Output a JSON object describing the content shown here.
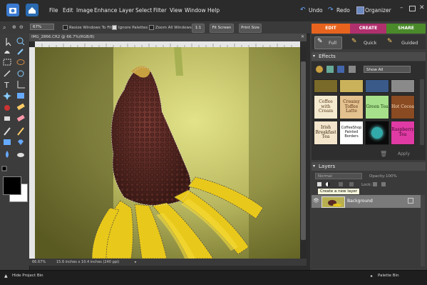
{
  "menubar": {
    "items": [
      "File",
      "Edit",
      "Image",
      "Enhance",
      "Layer",
      "Select",
      "Filter",
      "View",
      "Window",
      "Help"
    ],
    "undo": "Undo",
    "redo": "Redo",
    "organizer": "Organizer"
  },
  "options": {
    "zoom": "67%",
    "resize_windows": "Resize Windows To Fit",
    "ignore_palettes": "Ignore Palettes",
    "zoom_all": "Zoom All Windows",
    "one_to_one": "1:1",
    "fit_screen": "Fit Screen",
    "print_size": "Print Size"
  },
  "tabs": {
    "edit": "EDIT",
    "create": "CREATE",
    "share": "SHARE"
  },
  "modes": {
    "full": "Full",
    "quick": "Quick",
    "guided": "Guided"
  },
  "document": {
    "title": "IMG_2866.CR2 @ 66.7%(RGB/8)",
    "status_zoom": "66.67%",
    "status_info": "15.6 inches x 10.4 inches (240 ppi)"
  },
  "effects": {
    "header": "Effects",
    "show": "Show All",
    "apply": "Apply",
    "thumbs": [
      {
        "label": "",
        "bg": "#7a6a2a"
      },
      {
        "label": "",
        "bg": "#c9b25a"
      },
      {
        "label": "",
        "bg": "#3a5a8a"
      },
      {
        "label": "",
        "bg": "#8a8a8a"
      },
      {
        "label": "Coffee with Cream",
        "bg": "#f4ead0",
        "color": "#5a3a1a"
      },
      {
        "label": "Creamy Toffee Latte",
        "bg": "#e3c28f",
        "color": "#5a2a10"
      },
      {
        "label": "Green Tea",
        "bg": "#a6e08a",
        "color": "#1a3a10"
      },
      {
        "label": "Hot Cocoa",
        "bg": "#8a4a22",
        "color": "#f4e0c0"
      },
      {
        "label": "Irish Breakfast Tea",
        "bg": "#f3e6cc",
        "color": "#3a2410"
      },
      {
        "label": "CoffeeShop Painted Borders",
        "bg": "#ffffff",
        "color": "#111111"
      },
      {
        "label": "",
        "bg": "#0a0a0a"
      },
      {
        "label": "Raspberry Tea",
        "bg": "#e03aa4",
        "color": "#3a0a2a"
      }
    ]
  },
  "layers": {
    "header": "Layers",
    "blend": "Normal",
    "opacity_label": "Opacity:",
    "opacity": "100%",
    "lock_label": "Lock:",
    "tooltip": "Create a new layer",
    "layer_name": "Background"
  },
  "bottom": {
    "hide_bin": "Hide Project Bin",
    "palette_bin": "Palette Bin"
  },
  "colors": {
    "edit_tab": "#e8641e",
    "create_tab": "#b0306e",
    "share_tab": "#4a8a2a"
  }
}
